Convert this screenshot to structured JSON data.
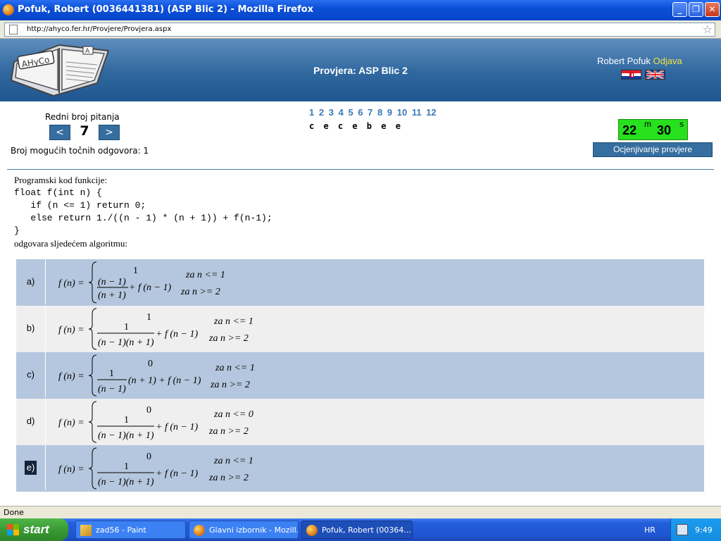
{
  "window": {
    "title": "Pofuk, Robert (0036441381) (ASP Blic 2) - Mozilla Firefox",
    "min_label": "_",
    "max_label": "❐",
    "close_label": "✕"
  },
  "browser": {
    "url": "http://ahyco.fer.hr/Provjere/Provjera.aspx"
  },
  "header": {
    "title": "Provjera: ASP Blic 2",
    "user": "Robert Pofuk",
    "logout": "Odjava",
    "logo_text": "AHyCo"
  },
  "controls": {
    "question_label": "Redni broj pitanja",
    "prev": "<",
    "next": ">",
    "current": "7",
    "possible_answers": "Broj mogućih točnih odgovora: 1",
    "question_links": [
      "1",
      "2",
      "3",
      "4",
      "5",
      "6",
      "7",
      "8",
      "9",
      "10",
      "11",
      "12"
    ],
    "given_answers": "c e c e b e e",
    "timer_minutes": "22",
    "timer_m": "m",
    "timer_seconds": "30",
    "timer_s": "s",
    "grade_button": "Ocjenjivanje provjere"
  },
  "question": {
    "intro": "Programski kod funkcije:",
    "code": [
      "float f(int n) {",
      "   if (n <= 1) return 0;",
      "   else return 1./((n - 1) * (n + 1)) + f(n-1);",
      "}"
    ],
    "outro": "odgovara sljedećem algoritmu:"
  },
  "answers": [
    {
      "letter": "a)",
      "top": "1",
      "cond1": "za n <= 1",
      "cond2": "za n  >=  2",
      "selected": false
    },
    {
      "letter": "b)",
      "top": "1",
      "cond1": "za n <= 1",
      "cond2": "za n  >=  2",
      "selected": false
    },
    {
      "letter": "c)",
      "top": "0",
      "cond1": "za n <= 1",
      "cond2": "za n  >=  2",
      "selected": false
    },
    {
      "letter": "d)",
      "top": "0",
      "cond1": "za n <= 0",
      "cond2": "za n  >=  2",
      "selected": false
    },
    {
      "letter": "e)",
      "top": "0",
      "cond1": "za n <= 1",
      "cond2": "za n  >=  2",
      "selected": true
    }
  ],
  "formula_text": {
    "lhs": "f (n) =",
    "num1": "(n − 1)",
    "den1": "(n + 1)",
    "plus_f": "+ f (n − 1)",
    "one": "1",
    "den_b": "(n − 1)(n + 1)",
    "mult_c": "(n + 1) + f (n − 1)"
  },
  "statusbar": {
    "text": "Done"
  },
  "taskbar": {
    "start": "start",
    "tasks": [
      "zad56 - Paint",
      "Glavni izbornik - Mozill...",
      "Pofuk, Robert (00364..."
    ],
    "lang": "HR",
    "clock": "9:49"
  },
  "colors": {
    "row_blue": "#b5c7de",
    "row_gray": "#efefef",
    "accent": "#356e9f",
    "timer_green": "#27e01e",
    "link_blue": "#3a78b8"
  }
}
